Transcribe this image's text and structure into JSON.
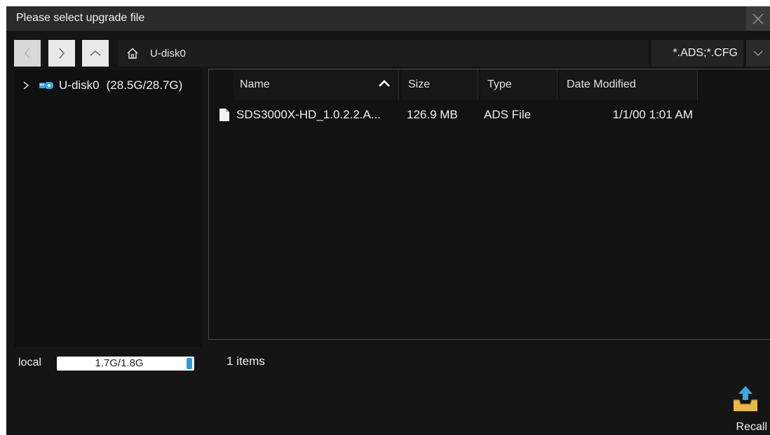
{
  "window": {
    "title": "Please select upgrade file"
  },
  "toolbar": {
    "back_icon": "chevron-left-icon",
    "forward_icon": "chevron-right-icon",
    "up_icon": "chevron-up-icon",
    "home_icon": "home-icon",
    "path": "U-disk0",
    "filter": "*.ADS;*.CFG",
    "filter_dropdown_icon": "chevron-down-icon"
  },
  "tree": {
    "items": [
      {
        "label": "U-disk0",
        "capacity": "(28.5G/28.7G)",
        "icon": "usb-drive-icon"
      }
    ]
  },
  "file_list": {
    "columns": [
      "Name",
      "Size",
      "Type",
      "Date Modified"
    ],
    "sort_column": "Name",
    "sort_direction": "ascending",
    "rows": [
      {
        "name": "SDS3000X-HD_1.0.2.2.A...",
        "size": "126.9 MB",
        "type": "ADS File",
        "date": "1/1/00 1:01 AM",
        "icon": "file-icon"
      }
    ]
  },
  "status": {
    "local_label": "local",
    "local_usage": "1.7G/1.8G",
    "local_fill_fraction": 0.94,
    "items_count": "1 items"
  },
  "actions": {
    "recall_label": "Recall",
    "recall_icon": "recall-tray-icon"
  },
  "colors": {
    "accent": "#2a9bd6",
    "background": "#151515",
    "titlebar": "#2b2b2b"
  }
}
